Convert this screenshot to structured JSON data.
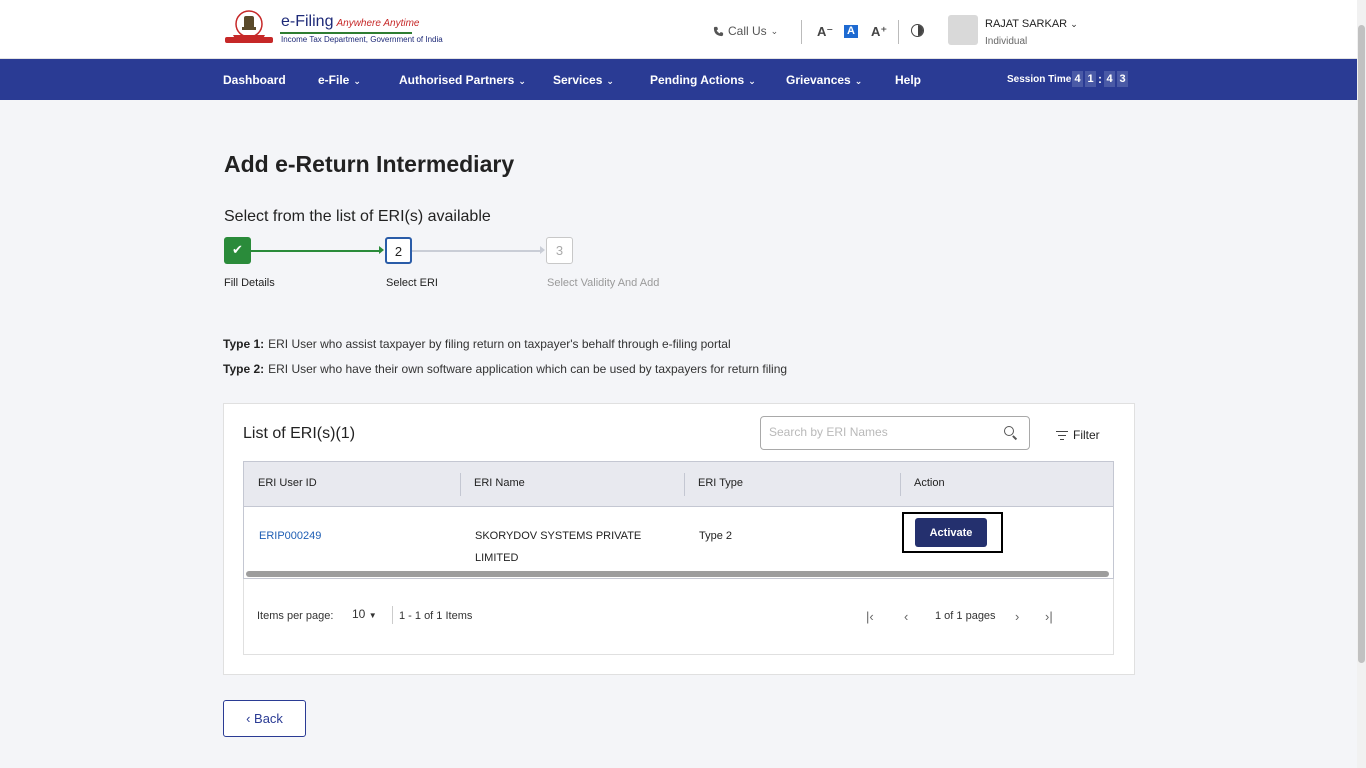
{
  "header": {
    "logo_title": "e-Filing",
    "logo_tagline": "Anywhere Anytime",
    "logo_subtitle": "Income Tax Department, Government of India",
    "call_us": "Call Us",
    "font_decrease": "A⁻",
    "font_default": "A",
    "font_increase": "A⁺",
    "user_name": "RAJAT SARKAR",
    "user_role": "Individual"
  },
  "nav": {
    "items": [
      {
        "label": "Dashboard"
      },
      {
        "label": "e-File"
      },
      {
        "label": "Authorised Partners"
      },
      {
        "label": "Services"
      },
      {
        "label": "Pending Actions"
      },
      {
        "label": "Grievances"
      },
      {
        "label": "Help"
      }
    ],
    "session_label": "Session Time",
    "timer": [
      "4",
      "1",
      "4",
      "3"
    ]
  },
  "page": {
    "title": "Add e-Return Intermediary",
    "subtitle": "Select from the list of ERI(s) available",
    "steps": [
      {
        "number": "✔",
        "label": "Fill Details",
        "status": "done"
      },
      {
        "number": "2",
        "label": "Select ERI",
        "status": "active"
      },
      {
        "number": "3",
        "label": "Select Validity And Add",
        "status": "pending"
      }
    ],
    "type1_label": "Type 1:",
    "type1_text": "ERI User who assist taxpayer by filing return on taxpayer's behalf through e-filing portal",
    "type2_label": "Type 2:",
    "type2_text": "ERI User who have their own software application which can be used by taxpayers for return filing"
  },
  "list": {
    "title": "List of ERI(s)(1)",
    "search_placeholder": "Search by ERI Names",
    "filter_label": "Filter",
    "columns": [
      "ERI User ID",
      "ERI Name",
      "ERI Type",
      "Action"
    ],
    "rows": [
      {
        "id": "ERIP000249",
        "name_line1": "SKORYDOV SYSTEMS PRIVATE",
        "name_line2": "LIMITED",
        "type": "Type 2",
        "action": "Activate"
      }
    ]
  },
  "pagination": {
    "items_per_page_label": "Items per page:",
    "items_per_page": "10",
    "range": "1 - 1 of 1 Items",
    "pages": "1 of 1 pages",
    "first": "|‹",
    "prev": "‹",
    "next": "›",
    "last": "›|"
  },
  "back_label": "‹ Back",
  "colors": {
    "nav_bg": "#2a3b94",
    "brand_green": "#2a8b3a",
    "activate_bg": "#24306e",
    "link": "#1e5eb4"
  }
}
